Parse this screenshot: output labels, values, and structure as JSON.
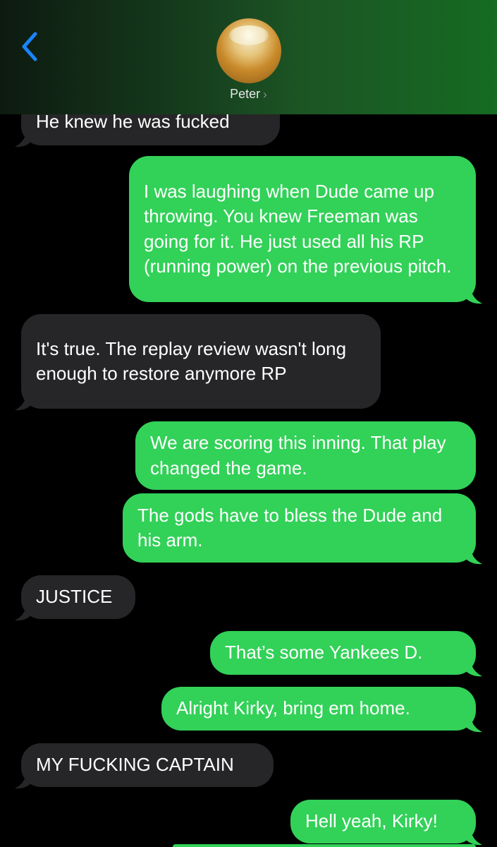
{
  "header": {
    "back_icon": "chevron-left-icon",
    "contact_name": "Peter",
    "contact_chevron": "›",
    "accent_color": "#1a84ff",
    "gradient_colors": [
      "#0d1a10",
      "#156b22"
    ]
  },
  "colors": {
    "incoming_bubble": "#262628",
    "outgoing_bubble": "#32d158",
    "text": "#ffffff"
  },
  "messages": [
    {
      "from": "Peter",
      "text": "He knew he was fucked"
    },
    {
      "from": "me",
      "text": "I was laughing when Dude came up throwing. You knew Freeman was going for it. He just used all his RP (running power) on the previous pitch."
    },
    {
      "from": "Peter",
      "text": "It's true. The replay review wasn't long enough to restore anymore RP"
    },
    {
      "from": "me",
      "text": "We are scoring this inning. That play changed the game."
    },
    {
      "from": "me",
      "text": "The gods have to bless the Dude and his arm."
    },
    {
      "from": "Peter",
      "text": "JUSTICE"
    },
    {
      "from": "me",
      "text": "That’s some Yankees D."
    },
    {
      "from": "me",
      "text": "Alright Kirky, bring em home."
    },
    {
      "from": "Peter",
      "text": "MY FUCKING CAPTAIN"
    },
    {
      "from": "me",
      "text": "Hell yeah, Kirky!"
    }
  ]
}
